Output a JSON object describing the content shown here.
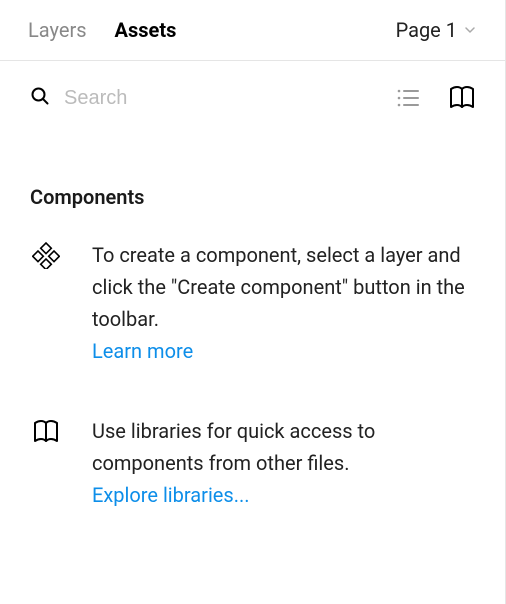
{
  "header": {
    "tabs": {
      "layers": "Layers",
      "assets": "Assets"
    },
    "page_label": "Page 1"
  },
  "search": {
    "placeholder": "Search"
  },
  "section": {
    "title": "Components",
    "items": [
      {
        "desc": "To create a component, select a layer and click the \"Create component\" button in the toolbar.",
        "link": "Learn more"
      },
      {
        "desc": "Use libraries for quick access to components from other files.",
        "link": "Explore libraries..."
      }
    ]
  }
}
